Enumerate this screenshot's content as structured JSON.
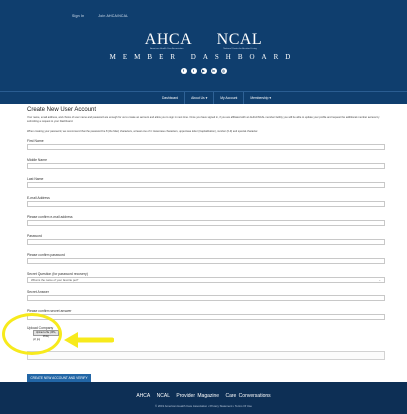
{
  "header": {
    "top_links": [
      "Sign In",
      "Join AHCA/NCAL"
    ],
    "logo_left": "AHCA",
    "logo_right": "NCAL",
    "logo_left_sub": "American Health Care Association",
    "logo_right_sub": "National Center for Assisted Living",
    "subtitle": "MEMBER DASHBOARD",
    "socials": [
      "f",
      "t",
      "▶",
      "in",
      "◎"
    ]
  },
  "nav": {
    "items": [
      "Dashboard",
      "About Us ▾",
      "My Account",
      "Membership ▾"
    ]
  },
  "form": {
    "title": "Create New User Account",
    "intro": "Your name, email address, and choice of user name and password are enough for us to create an account and allow you to sign in next time. Once you have signed in, if you are affiliated with an AHCA/NCAL member facility you will be able to update your profile and request the additional member access by submitting a request to your Dashboard.",
    "password_hint": "When creating your password, we recommend that the password be 8 (the Max) characters, at least one of it: lowercase characters, uppercase letter (Capitalization), number (0-9) and special character.",
    "fields": {
      "first_name": "First Name",
      "middle_name": "Middle Name",
      "last_name": "Last Name",
      "email": "E-mail Address",
      "confirm_email": "Please confirm e-mail address",
      "password": "Password",
      "confirm_password": "Please confirm password",
      "security_question": "Secret Question (for password recovery)",
      "security_placeholder": "What is the name of your favorite pet?",
      "secret_answer": "Secret Answer",
      "confirm_answer": "Please confirm secret answer",
      "photo_label": "Upload Company"
    },
    "photo_button": "Upload a file (JPG, PNG)",
    "photo_note": "gif, jpg",
    "submit": "CREATE NEW ACCOUNT AND VERIFY"
  },
  "footer": {
    "links": [
      "AHCA",
      "NCAL",
      "Provider Magazine",
      "Care Conversations"
    ],
    "copyright": "© 2019 American Health Care Association • Privacy Statement • Terms Of Use"
  },
  "annotation": {
    "highlight_color": "#f7ea1c"
  }
}
